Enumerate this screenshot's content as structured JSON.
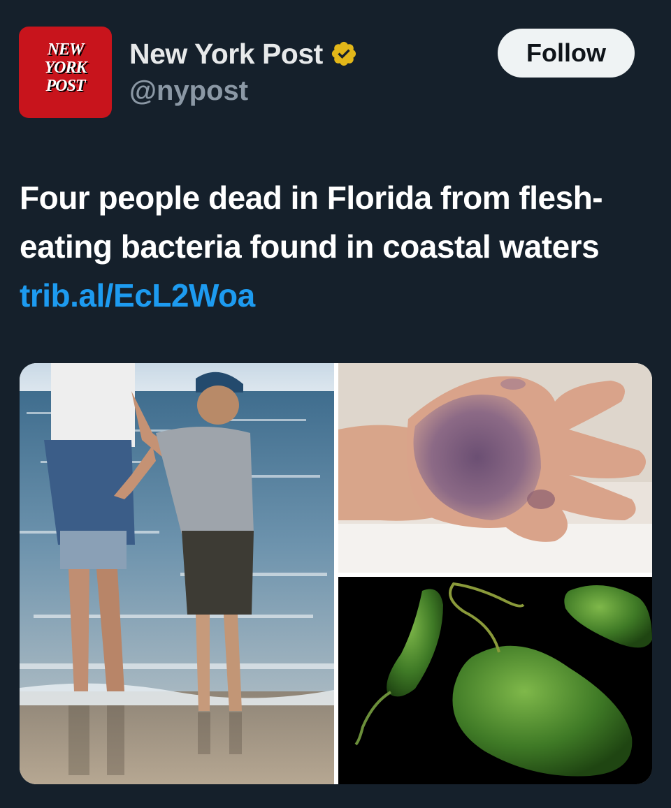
{
  "account": {
    "avatar_logo_lines": [
      "NEW",
      "YORK",
      "POST"
    ],
    "display_name": "New York Post",
    "handle": "@nypost",
    "verified_icon": "verified-gold-badge-icon",
    "brand_color": "#c8141c",
    "badge_color": "#e2b719"
  },
  "follow_button": {
    "label": "Follow"
  },
  "tweet": {
    "text": "Four people dead in Florida from flesh-eating bacteria found in coastal waters ",
    "link": "trib.al/EcL2Woa",
    "link_color": "#1d9bf0"
  },
  "media": {
    "images": [
      {
        "name": "beach-photo"
      },
      {
        "name": "infected-hand-photo"
      },
      {
        "name": "bacteria-illustration"
      }
    ]
  },
  "theme": {
    "background": "#15202b"
  }
}
